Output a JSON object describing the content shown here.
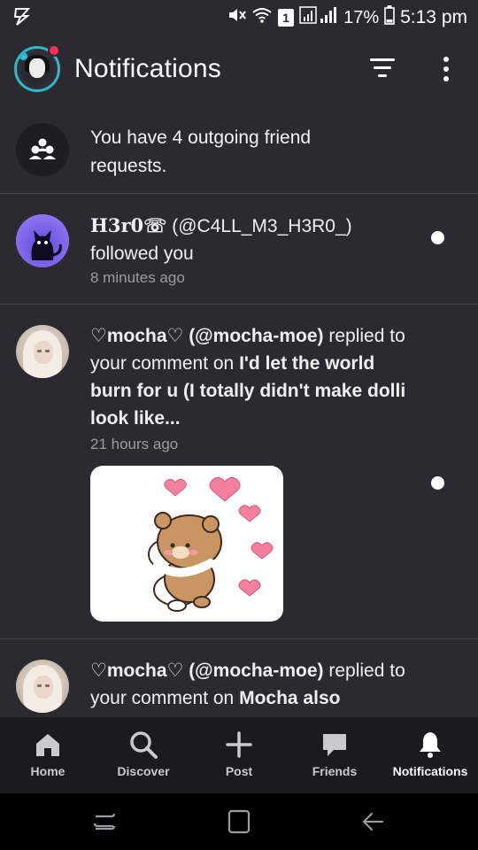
{
  "status_bar": {
    "battery": "17%",
    "time": "5:13 pm",
    "notification_count": "1"
  },
  "header": {
    "title": "Notifications",
    "filter_icon": "filter-icon",
    "more_icon": "more-vertical-icon",
    "badge_color": "#ff2d5a"
  },
  "friend_requests": {
    "text": "You have 4 outgoing friend requests.",
    "icon": "people-group-icon"
  },
  "notifications": [
    {
      "display_name": "H3r0☏",
      "handle": "(@C4LL_M3_H3R0_)",
      "action": "followed you",
      "time": "8 minutes ago",
      "unread": true
    },
    {
      "display_name": "♡mocha♡",
      "handle": "(@mocha-moe)",
      "action_pre": "replied",
      "action_mid": "to your comment on",
      "target": "I'd let the world burn for u (I totally didn't make dolli look like...",
      "time": "21 hours ago",
      "unread": true,
      "attachment": "bear-hug-sticker"
    },
    {
      "display_name": "♡mocha♡",
      "handle": "(@mocha-moe)",
      "action_pre": "replied",
      "action_mid": "to your comment on",
      "target": "Mocha also"
    }
  ],
  "bottom_nav": {
    "items": [
      {
        "label": "Home",
        "icon": "home-icon"
      },
      {
        "label": "Discover",
        "icon": "search-icon"
      },
      {
        "label": "Post",
        "icon": "plus-icon"
      },
      {
        "label": "Friends",
        "icon": "chat-bubble-icon"
      },
      {
        "label": "Notifications",
        "icon": "bell-icon",
        "active": true
      }
    ]
  },
  "colors": {
    "background": "#2b2a31",
    "nav_background": "#1b1b1f",
    "accent_ring": "#2fb8c9"
  }
}
